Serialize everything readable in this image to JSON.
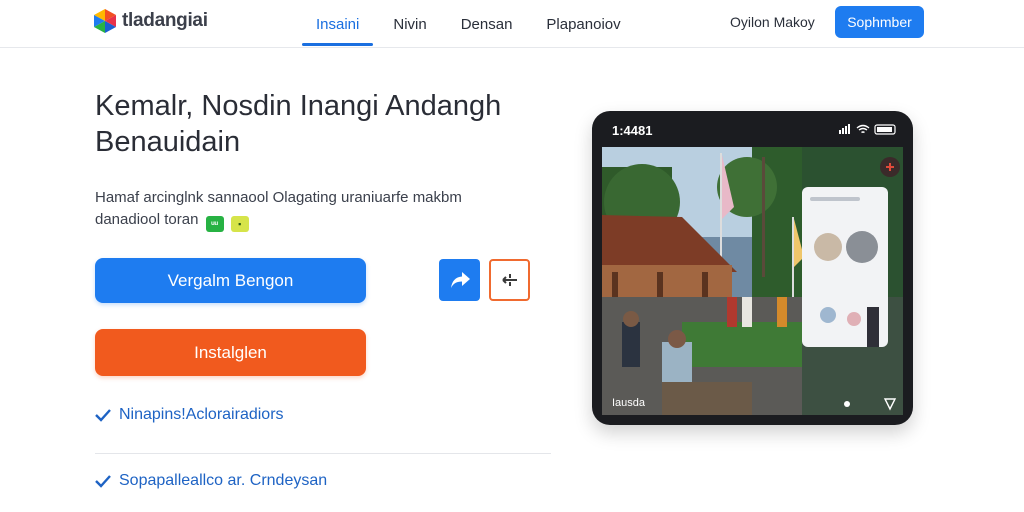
{
  "app": {
    "logo_text": "tladangiai"
  },
  "nav": {
    "items": [
      {
        "label": "Insaini",
        "active": true
      },
      {
        "label": "Nivin",
        "active": false
      },
      {
        "label": "Densan",
        "active": false
      },
      {
        "label": "Plapanoiov",
        "active": false
      }
    ]
  },
  "header": {
    "link_label": "Oyilon Makoy",
    "button_label": "Sophmber"
  },
  "hero": {
    "title": "Kemalr, Nosdin Inangi Andangh Benauidain",
    "subtitle_line1": "Hamaf arcinglnk sannaool Olagating uraniuarfe makbm",
    "subtitle_line2": "danadiool toran",
    "badge1": "ᵘᵘ",
    "badge2": "",
    "primary_button": "Vergalm Bengon",
    "secondary_button": "Instalglen",
    "features": [
      "Ninapins!Aclorairadiors",
      "Sopapalleallco ar. Crndeysan"
    ]
  },
  "phone": {
    "time": "1:4481",
    "bottom_label": "Iausda"
  },
  "colors": {
    "accent": "#1e7cf0",
    "orange": "#f15a1e",
    "link": "#1e63c4"
  },
  "icons": {
    "share": "share-arrow-icon",
    "move": "move-arrows-icon",
    "check": "check-icon"
  }
}
